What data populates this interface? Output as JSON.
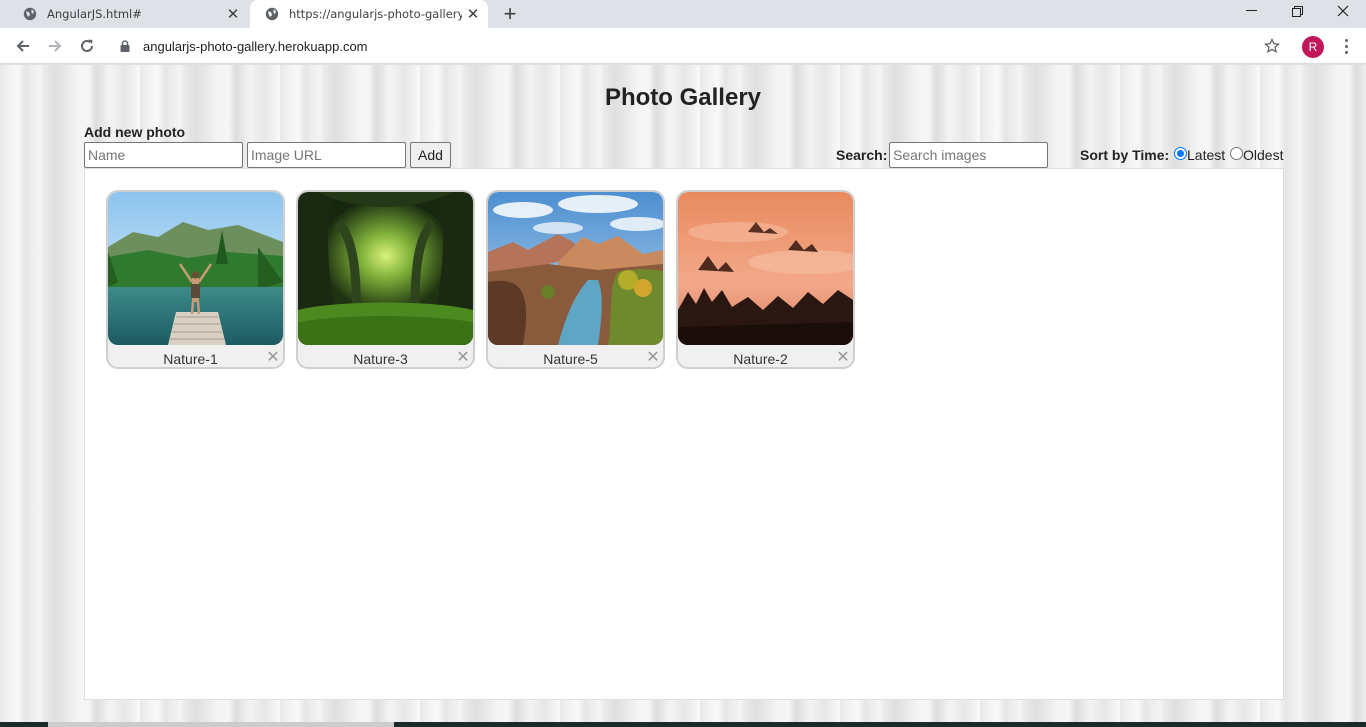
{
  "browser": {
    "tabs": [
      {
        "title": "AngularJS.html#",
        "active": false
      },
      {
        "title": "https://angularjs-photo-gallery.h",
        "active": true
      }
    ],
    "url": "angularjs-photo-gallery.herokuapp.com",
    "profile_initial": "R",
    "colors": {
      "tabstrip": "#dee1e6",
      "avatar": "#c2185b"
    }
  },
  "page": {
    "title": "Photo Gallery",
    "add_section": {
      "label": "Add new photo",
      "name_placeholder": "Name",
      "url_placeholder": "Image URL",
      "add_button": "Add"
    },
    "search": {
      "label": "Search:",
      "placeholder": "Search images"
    },
    "sort": {
      "label": "Sort by Time:",
      "options": [
        {
          "label": "Latest",
          "selected": true
        },
        {
          "label": "Oldest",
          "selected": false
        }
      ]
    },
    "photos": [
      {
        "name": "Nature-1",
        "remove": "✕",
        "scene": "lake-dock"
      },
      {
        "name": "Nature-3",
        "remove": "✕",
        "scene": "forest-tunnel"
      },
      {
        "name": "Nature-5",
        "remove": "✕",
        "scene": "canyon-river"
      },
      {
        "name": "Nature-2",
        "remove": "✕",
        "scene": "misty-sunset"
      }
    ]
  }
}
